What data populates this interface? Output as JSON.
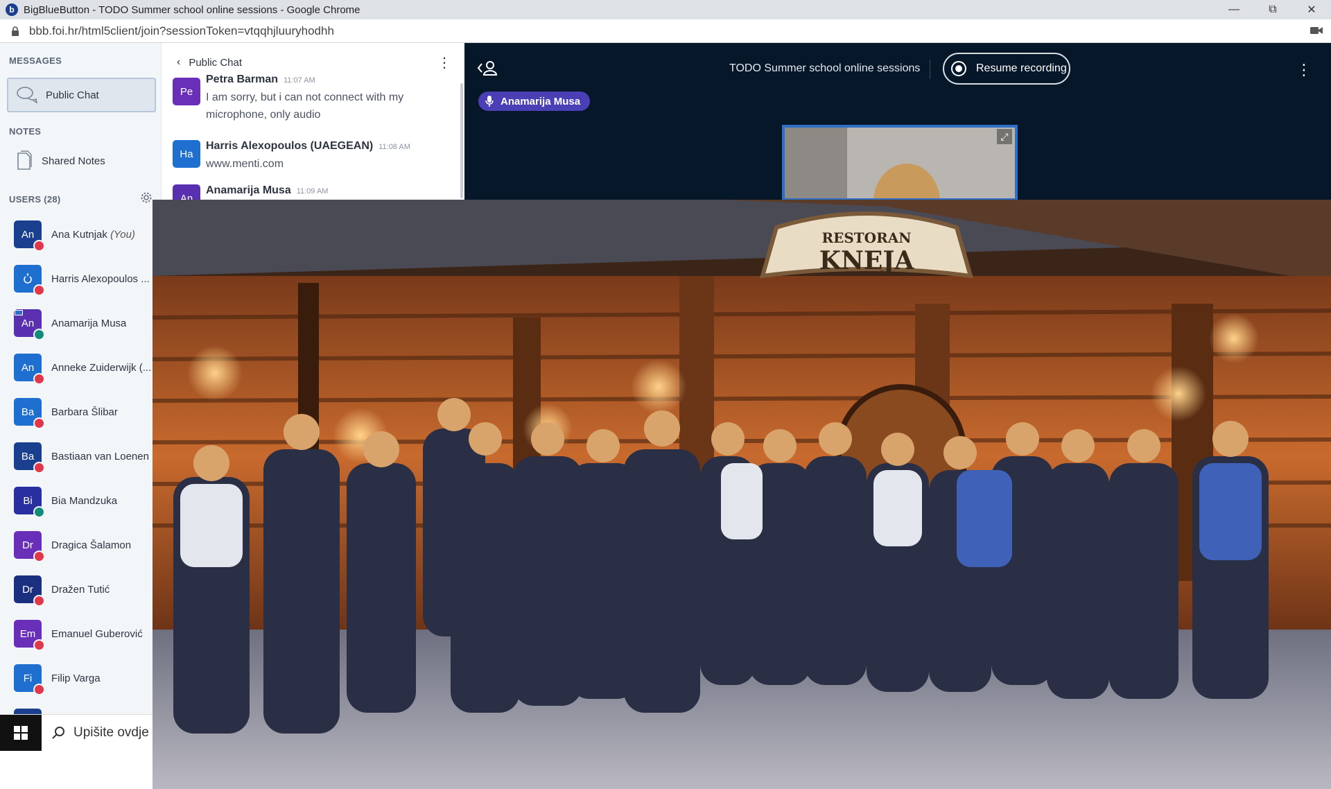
{
  "window": {
    "title": "BigBlueButton - TODO Summer school online sessions - Google Chrome",
    "app_icon_letter": "b",
    "url": "bbb.foi.hr/html5client/join?sessionToken=vtqqhjluuryhodhh"
  },
  "sidebar": {
    "messages_heading": "MESSAGES",
    "public_chat_label": "Public Chat",
    "notes_heading": "NOTES",
    "shared_notes_label": "Shared Notes",
    "users_heading": "USERS (28)",
    "users": [
      {
        "initials": "An",
        "name": "Ana Kutnjak",
        "suffix": "(You)",
        "color": "#1b3f8f",
        "status": "#e0374a"
      },
      {
        "initials": "",
        "name": "Harris Alexopoulos ...",
        "suffix": "",
        "color": "#1f6fd0",
        "status": "#e0374a"
      },
      {
        "initials": "An",
        "name": "Anamarija Musa",
        "suffix": "",
        "color": "#5a2fb0",
        "status": "#138a7a"
      },
      {
        "initials": "An",
        "name": "Anneke Zuiderwijk (...",
        "suffix": "",
        "color": "#1f6fd0",
        "status": "#e0374a"
      },
      {
        "initials": "Ba",
        "name": "Barbara Šlibar",
        "suffix": "",
        "color": "#1f6fd0",
        "status": "#e0374a"
      },
      {
        "initials": "Ba",
        "name": "Bastiaan van Loenen",
        "suffix": "",
        "color": "#1b3f8f",
        "status": "#e0374a"
      },
      {
        "initials": "Bi",
        "name": "Bia Mandzuka",
        "suffix": "",
        "color": "#2a2fa0",
        "status": "#138a7a"
      },
      {
        "initials": "Dr",
        "name": "Dragica Šalamon",
        "suffix": "",
        "color": "#6a2fb8",
        "status": "#e0374a"
      },
      {
        "initials": "Dr",
        "name": "Dražen Tutić",
        "suffix": "",
        "color": "#1b2f80",
        "status": "#e0374a"
      },
      {
        "initials": "Em",
        "name": "Emanuel Guberović",
        "suffix": "",
        "color": "#6a2fb8",
        "status": "#e0374a"
      },
      {
        "initials": "Fi",
        "name": "Filip Varga",
        "suffix": "",
        "color": "#1f6fd0",
        "status": "#e0374a"
      }
    ]
  },
  "chat": {
    "back_label": "Public Chat",
    "messages": [
      {
        "initials": "Pe",
        "sender": "Petra Barman",
        "time": "11:07 AM",
        "color": "#6a2fb8",
        "text": "I am sorry, but i can not connect with my microphone, only audio"
      },
      {
        "initials": "Ha",
        "sender": "Harris Alexopoulos (UAEGEAN)",
        "time": "11:08 AM",
        "color": "#1f6fd0",
        "text": "www.menti.com"
      },
      {
        "initials": "An",
        "sender": "Anamarija Musa",
        "time": "11:09 AM",
        "color": "#5a2fb0",
        "text": ""
      }
    ]
  },
  "presentation": {
    "meeting_title": "TODO Summer school online sessions",
    "record_label": "Resume recording",
    "talker_name": "Anamarija Musa"
  },
  "photo": {
    "sign_top": "RESTORAN",
    "sign_main": "KNEJA"
  },
  "taskbar": {
    "search_placeholder": "Upišite ovdje"
  }
}
